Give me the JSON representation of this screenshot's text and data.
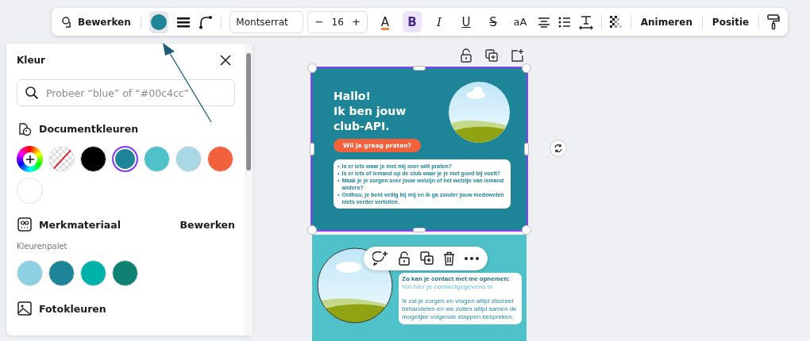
{
  "toolbar": {
    "edit_label": "Bewerken",
    "color_selected": true,
    "font": "Montserrat",
    "size_minus": "−",
    "size": "16",
    "size_plus": "+",
    "format_buttons": [
      {
        "kind": "text-color",
        "label": "A",
        "selected": false
      },
      {
        "kind": "bold",
        "label": "B",
        "selected": true
      },
      {
        "kind": "italic",
        "label": "I",
        "selected": false
      },
      {
        "kind": "underline",
        "label": "U",
        "selected": false
      },
      {
        "kind": "strike",
        "label": "S",
        "selected": false
      },
      {
        "kind": "case",
        "label": "aA",
        "selected": false
      }
    ],
    "animate": "Animeren",
    "position": "Positie"
  },
  "color_panel": {
    "title": "Kleur",
    "search": {
      "placeholder": "Probeer “blue” of “#00c4cc”"
    },
    "document_section": "Documentkleuren",
    "document_colors": [
      {
        "kind": "add",
        "selected": false
      },
      {
        "kind": "transparent",
        "selected": false
      },
      {
        "kind": "swatch",
        "color": "#000000",
        "selected": false
      },
      {
        "kind": "swatch",
        "color": "#1e8497",
        "selected": true
      },
      {
        "kind": "swatch",
        "color": "#4fc1c9",
        "selected": false
      },
      {
        "kind": "swatch",
        "color": "#a9d7e4",
        "selected": false
      },
      {
        "kind": "swatch",
        "color": "#f2603c",
        "selected": false
      },
      {
        "kind": "swatch",
        "color": "#ffffff",
        "selected": false
      }
    ],
    "brand_section": "Merkmateriaal",
    "brand_action": "Bewerken",
    "palette_label": "Kleurenpalet",
    "palette_colors": [
      {
        "color": "#8dcfe3"
      },
      {
        "color": "#1e8497"
      },
      {
        "color": "#00b2a9"
      },
      {
        "color": "#0e8173"
      }
    ],
    "photo_section": "Fotokleuren"
  },
  "pages": [
    {
      "selected": true,
      "bullet_marker": "•",
      "heading": "Hallo!\nIk ben jouw\nclub-API.",
      "cta": "Wil je graag praten?",
      "bullets": [
        "Is er iets waar je met mij over wilt praten?",
        "Is er iets of iemand op de club waar je je niet goed bij voelt?",
        "Maak je je zorgen over jouw welzijn of het welzijn van iemand anders?",
        "Onthou, je bent veilig bij mij en ik ga zonder jouw medeweten niets verder vertellen."
      ]
    },
    {
      "contact_title": "Zo kan je contact met me opnemen:",
      "contact_link": "Vul hier je contactgegevens in",
      "body": "Ik zal je zorgen en vragen altijd discreet behandelen en we zullen altijd samen de mogelijke volgende stappen bespreken."
    }
  ]
}
